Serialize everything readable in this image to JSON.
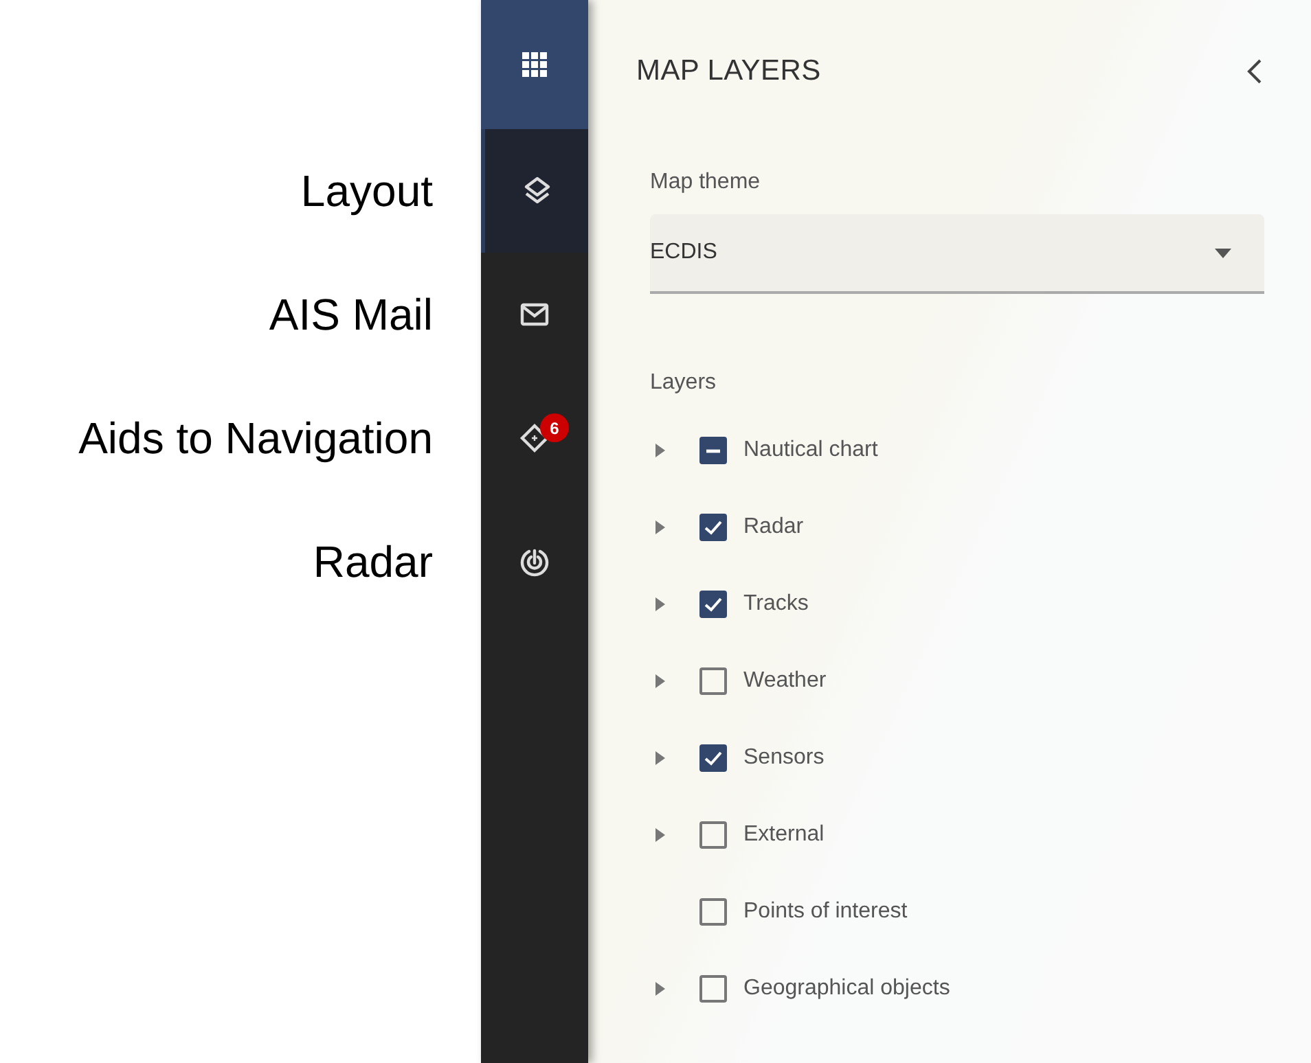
{
  "callouts": [
    "Layout",
    "AIS Mail",
    "Aids to Navigation",
    "Radar"
  ],
  "rail": {
    "items": [
      {
        "kind": "apps",
        "selected": false
      },
      {
        "kind": "layers",
        "selected": true
      },
      {
        "kind": "mail",
        "selected": false
      },
      {
        "kind": "aton",
        "selected": false,
        "badge": "6"
      },
      {
        "kind": "radar",
        "selected": false
      }
    ]
  },
  "panel": {
    "title": "MAP LAYERS",
    "theme": {
      "label": "Map theme",
      "value": "ECDIS"
    },
    "layers_label": "Layers",
    "layers": [
      {
        "name": "Nautical chart",
        "expandable": true,
        "checked": false,
        "indeterminate": true
      },
      {
        "name": "Radar",
        "expandable": true,
        "checked": true,
        "indeterminate": false
      },
      {
        "name": "Tracks",
        "expandable": true,
        "checked": true,
        "indeterminate": false
      },
      {
        "name": "Weather",
        "expandable": true,
        "checked": false,
        "indeterminate": false
      },
      {
        "name": "Sensors",
        "expandable": true,
        "checked": true,
        "indeterminate": false
      },
      {
        "name": "External",
        "expandable": true,
        "checked": false,
        "indeterminate": false
      },
      {
        "name": "Points of interest",
        "expandable": false,
        "checked": false,
        "indeterminate": false
      },
      {
        "name": "Geographical objects",
        "expandable": true,
        "checked": false,
        "indeterminate": false
      }
    ]
  }
}
